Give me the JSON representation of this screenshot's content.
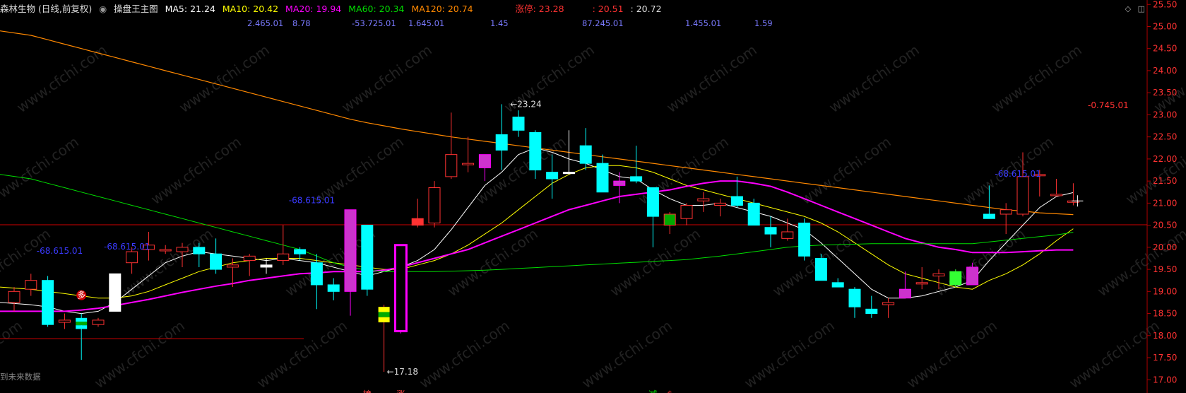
{
  "header": {
    "stock_name": "森林生物 (日线,前复权)",
    "indicator_name": "操盘王主图",
    "ma5": "MA5: 21.24",
    "ma10": "MA10: 20.42",
    "ma20": "MA20: 19.94",
    "ma60": "MA60: 20.34",
    "ma120": "MA120: 20.74",
    "limit_up": "涨停: 23.28",
    "extra1": ": 20.51",
    "extra2": ": 20.72"
  },
  "row2_values": [
    "2.465.01",
    "8.78",
    "-53.725.01",
    "1.645.01",
    "1.45",
    "87.245.01",
    "1.455.01",
    "1.59"
  ],
  "footer_hint": "到未来数据",
  "icons": [
    "diamond-icon",
    "layout-icon"
  ],
  "colors": {
    "up": "#ff3232",
    "down": "#00ffff",
    "ma5": "#ffffff",
    "ma10": "#ffff00",
    "ma20": "#ff00ff",
    "ma60": "#00dd00",
    "ma120": "#ff8800",
    "support": "#d00000"
  },
  "chart_data": {
    "type": "candlestick",
    "ylim": [
      16.7,
      25.6
    ],
    "y_ticks": [
      "25.50",
      "25.00",
      "24.50",
      "24.00",
      "23.50",
      "23.00",
      "22.50",
      "22.00",
      "21.50",
      "21.00",
      "20.50",
      "20.00",
      "19.50",
      "19.00",
      "18.50",
      "18.00",
      "17.50",
      "17.00"
    ],
    "candles": [
      {
        "o": 18.75,
        "h": 19.1,
        "l": 18.55,
        "c": 19.0
      },
      {
        "o": 19.05,
        "h": 19.4,
        "l": 18.9,
        "c": 19.25
      },
      {
        "o": 19.25,
        "h": 19.35,
        "l": 18.2,
        "c": 18.25
      },
      {
        "o": 18.3,
        "h": 18.5,
        "l": 18.15,
        "c": 18.35
      },
      {
        "o": 18.4,
        "h": 18.5,
        "l": 17.45,
        "c": 18.15
      },
      {
        "o": 18.25,
        "h": 18.4,
        "l": 18.2,
        "c": 18.35
      },
      {
        "o": 18.55,
        "h": 19.4,
        "l": 18.55,
        "c": 19.4
      },
      {
        "o": 19.65,
        "h": 20.0,
        "l": 19.4,
        "c": 19.9
      },
      {
        "o": 19.95,
        "h": 20.35,
        "l": 19.7,
        "c": 20.05
      },
      {
        "o": 19.95,
        "h": 20.05,
        "l": 19.85,
        "c": 19.95
      },
      {
        "o": 19.9,
        "h": 20.1,
        "l": 19.55,
        "c": 20.0
      },
      {
        "o": 20.0,
        "h": 20.1,
        "l": 19.55,
        "c": 19.85
      },
      {
        "o": 19.85,
        "h": 20.2,
        "l": 19.4,
        "c": 19.5
      },
      {
        "o": 19.55,
        "h": 19.75,
        "l": 19.1,
        "c": 19.6
      },
      {
        "o": 19.7,
        "h": 19.85,
        "l": 19.35,
        "c": 19.8
      },
      {
        "o": 19.6,
        "h": 19.75,
        "l": 19.4,
        "c": 19.55
      },
      {
        "o": 19.7,
        "h": 20.5,
        "l": 19.6,
        "c": 19.85
      },
      {
        "o": 19.95,
        "h": 20.0,
        "l": 19.7,
        "c": 19.85
      },
      {
        "o": 19.65,
        "h": 19.85,
        "l": 18.6,
        "c": 19.15
      },
      {
        "o": 19.15,
        "h": 19.3,
        "l": 18.8,
        "c": 19.0
      },
      {
        "o": 20.85,
        "h": 20.85,
        "l": 18.45,
        "c": 19.0
      },
      {
        "o": 20.5,
        "h": 20.5,
        "l": 18.9,
        "c": 19.05
      },
      {
        "o": 18.3,
        "h": 18.7,
        "l": 17.18,
        "c": 18.65
      },
      {
        "o": 18.1,
        "h": 20.05,
        "l": 18.05,
        "c": 20.05
      },
      {
        "o": 20.5,
        "h": 21.1,
        "l": 20.45,
        "c": 20.65
      },
      {
        "o": 20.55,
        "h": 21.5,
        "l": 20.45,
        "c": 21.35
      },
      {
        "o": 21.6,
        "h": 23.05,
        "l": 21.55,
        "c": 22.1
      },
      {
        "o": 21.9,
        "h": 22.5,
        "l": 21.7,
        "c": 21.9
      },
      {
        "o": 22.1,
        "h": 22.1,
        "l": 21.5,
        "c": 21.8
      },
      {
        "o": 22.55,
        "h": 23.24,
        "l": 21.75,
        "c": 22.2
      },
      {
        "o": 22.95,
        "h": 23.1,
        "l": 22.5,
        "c": 22.65
      },
      {
        "o": 22.6,
        "h": 22.65,
        "l": 21.55,
        "c": 21.75
      },
      {
        "o": 21.7,
        "h": 22.1,
        "l": 21.1,
        "c": 21.55
      },
      {
        "o": 21.7,
        "h": 22.65,
        "l": 21.65,
        "c": 21.7
      },
      {
        "o": 22.3,
        "h": 22.7,
        "l": 21.75,
        "c": 21.9
      },
      {
        "o": 21.9,
        "h": 22.1,
        "l": 21.25,
        "c": 21.25
      },
      {
        "o": 21.5,
        "h": 21.7,
        "l": 21.0,
        "c": 21.4
      },
      {
        "o": 21.6,
        "h": 22.3,
        "l": 21.45,
        "c": 21.5
      },
      {
        "o": 21.35,
        "h": 21.35,
        "l": 20.0,
        "c": 20.7
      },
      {
        "o": 20.5,
        "h": 20.8,
        "l": 20.3,
        "c": 20.75
      },
      {
        "o": 20.65,
        "h": 21.0,
        "l": 20.5,
        "c": 20.95
      },
      {
        "o": 21.05,
        "h": 21.25,
        "l": 20.8,
        "c": 21.1
      },
      {
        "o": 20.95,
        "h": 21.1,
        "l": 20.7,
        "c": 21.0
      },
      {
        "o": 21.15,
        "h": 21.6,
        "l": 20.9,
        "c": 20.95
      },
      {
        "o": 21.0,
        "h": 21.1,
        "l": 20.5,
        "c": 20.5
      },
      {
        "o": 20.45,
        "h": 20.7,
        "l": 20.0,
        "c": 20.3
      },
      {
        "o": 20.2,
        "h": 20.65,
        "l": 20.15,
        "c": 20.35
      },
      {
        "o": 20.55,
        "h": 20.65,
        "l": 19.7,
        "c": 19.8
      },
      {
        "o": 19.75,
        "h": 19.85,
        "l": 19.25,
        "c": 19.25
      },
      {
        "o": 19.2,
        "h": 19.3,
        "l": 19.1,
        "c": 19.1
      },
      {
        "o": 19.05,
        "h": 19.1,
        "l": 18.4,
        "c": 18.65
      },
      {
        "o": 18.6,
        "h": 18.9,
        "l": 18.4,
        "c": 18.5
      },
      {
        "o": 18.7,
        "h": 18.85,
        "l": 18.4,
        "c": 18.75
      },
      {
        "o": 18.85,
        "h": 19.45,
        "l": 18.85,
        "c": 19.05
      },
      {
        "o": 19.2,
        "h": 19.55,
        "l": 19.05,
        "c": 19.2
      },
      {
        "o": 19.35,
        "h": 19.5,
        "l": 19.05,
        "c": 19.4
      },
      {
        "o": 19.45,
        "h": 19.5,
        "l": 19.1,
        "c": 19.15
      },
      {
        "o": 19.15,
        "h": 19.65,
        "l": 19.15,
        "c": 19.55
      },
      {
        "o": 20.65,
        "h": 21.4,
        "l": 20.65,
        "c": 20.75
      },
      {
        "o": 20.75,
        "h": 21.0,
        "l": 20.3,
        "c": 20.85
      },
      {
        "o": 20.75,
        "h": 22.15,
        "l": 20.7,
        "c": 21.6
      },
      {
        "o": 21.65,
        "h": 21.75,
        "l": 21.15,
        "c": 21.65
      },
      {
        "o": 21.2,
        "h": 21.55,
        "l": 21.15,
        "c": 21.2
      },
      {
        "o": 21.05,
        "h": 21.45,
        "l": 20.95,
        "c": 21.05
      }
    ],
    "candle_styles": {
      "2": "cyan",
      "4": "green-yellow",
      "6": "white",
      "15": "white",
      "20": "magenta",
      "22": "yellow-green",
      "23": "magenta-hollow",
      "24": "red-fill",
      "28": "magenta",
      "33": "white",
      "36": "magenta",
      "39": "green",
      "53": "magenta",
      "56": "lime",
      "57": "magenta",
      "58": "cyan"
    },
    "ma_series": [
      {
        "name": "MA5",
        "values": [
          18.75,
          18.7,
          18.65,
          18.55,
          18.5,
          18.55,
          18.75,
          19.05,
          19.35,
          19.65,
          19.8,
          19.9,
          19.85,
          19.8,
          19.75,
          19.7,
          19.75,
          19.7,
          19.65,
          19.55,
          19.45,
          19.35,
          19.45,
          19.55,
          19.7,
          19.95,
          20.4,
          20.9,
          21.4,
          21.7,
          22.1,
          22.25,
          22.15,
          22.0,
          21.9,
          21.75,
          21.6,
          21.55,
          21.3,
          21.1,
          20.95,
          20.95,
          21.0,
          20.9,
          20.8,
          20.7,
          20.55,
          20.4,
          20.1,
          19.75,
          19.4,
          19.05,
          18.85,
          18.85,
          18.9,
          19.0,
          19.1,
          19.25,
          19.7,
          20.1,
          20.5,
          20.9,
          21.15,
          21.24
        ]
      },
      {
        "name": "MA10",
        "values": [
          19.1,
          19.05,
          19.0,
          18.95,
          18.9,
          18.85,
          18.85,
          18.9,
          19.0,
          19.15,
          19.3,
          19.45,
          19.55,
          19.65,
          19.7,
          19.75,
          19.75,
          19.75,
          19.7,
          19.65,
          19.6,
          19.55,
          19.5,
          19.5,
          19.6,
          19.7,
          19.85,
          20.05,
          20.3,
          20.55,
          20.85,
          21.15,
          21.45,
          21.65,
          21.8,
          21.85,
          21.85,
          21.8,
          21.7,
          21.55,
          21.4,
          21.3,
          21.2,
          21.1,
          21.0,
          20.9,
          20.8,
          20.7,
          20.55,
          20.35,
          20.1,
          19.85,
          19.6,
          19.4,
          19.3,
          19.2,
          19.1,
          19.05,
          19.25,
          19.4,
          19.6,
          19.85,
          20.15,
          20.42
        ]
      },
      {
        "name": "MA20",
        "values": [
          18.55,
          18.55,
          18.55,
          18.55,
          18.58,
          18.62,
          18.68,
          18.75,
          18.82,
          18.9,
          18.98,
          19.05,
          19.12,
          19.18,
          19.25,
          19.3,
          19.35,
          19.4,
          19.42,
          19.45,
          19.45,
          19.45,
          19.48,
          19.55,
          19.65,
          19.75,
          19.85,
          19.95,
          20.1,
          20.25,
          20.4,
          20.55,
          20.7,
          20.85,
          20.95,
          21.05,
          21.15,
          21.2,
          21.25,
          21.3,
          21.38,
          21.45,
          21.5,
          21.5,
          21.45,
          21.38,
          21.25,
          21.1,
          20.95,
          20.8,
          20.65,
          20.5,
          20.35,
          20.2,
          20.1,
          20.0,
          19.95,
          19.88,
          19.88,
          19.88,
          19.9,
          19.92,
          19.94,
          19.94
        ]
      },
      {
        "name": "MA60",
        "values": [
          21.65,
          21.55,
          21.45,
          21.35,
          21.25,
          21.15,
          21.05,
          20.95,
          20.85,
          20.75,
          20.65,
          20.55,
          20.45,
          20.35,
          20.25,
          20.15,
          20.05,
          19.95,
          19.8,
          19.65,
          19.55,
          19.48,
          19.45,
          19.45,
          19.45,
          19.45,
          19.46,
          19.47,
          19.48,
          19.5,
          19.52,
          19.54,
          19.56,
          19.58,
          19.6,
          19.62,
          19.64,
          19.66,
          19.68,
          19.7,
          19.72,
          19.76,
          19.8,
          19.85,
          19.9,
          19.95,
          20.0,
          20.03,
          20.05,
          20.06,
          20.07,
          20.08,
          20.08,
          20.08,
          20.08,
          20.08,
          20.08,
          20.08,
          20.12,
          20.16,
          20.2,
          20.24,
          20.28,
          20.34
        ]
      },
      {
        "name": "MA120",
        "values": [
          24.9,
          24.8,
          24.7,
          24.6,
          24.5,
          24.4,
          24.3,
          24.2,
          24.1,
          24.0,
          23.9,
          23.8,
          23.7,
          23.6,
          23.5,
          23.4,
          23.3,
          23.2,
          23.1,
          23.0,
          22.9,
          22.82,
          22.75,
          22.68,
          22.62,
          22.56,
          22.5,
          22.45,
          22.4,
          22.35,
          22.3,
          22.25,
          22.2,
          22.15,
          22.1,
          22.05,
          22.0,
          21.95,
          21.9,
          21.85,
          21.8,
          21.75,
          21.7,
          21.65,
          21.6,
          21.55,
          21.5,
          21.45,
          21.4,
          21.35,
          21.3,
          21.25,
          21.2,
          21.15,
          21.1,
          21.05,
          21.0,
          20.95,
          20.9,
          20.85,
          20.82,
          20.78,
          20.76,
          20.74
        ]
      }
    ],
    "support_lines": [
      20.51,
      17.93
    ],
    "annotations": [
      {
        "text": "23.24",
        "at_candle": 29,
        "price": 23.24
      },
      {
        "text": "17.18",
        "at_candle": 22,
        "price": 17.18
      },
      {
        "text": "-0.745.01",
        "price": 23.15,
        "side": "right"
      },
      {
        "text": "-68.615.01",
        "at_candle": 1,
        "price": 19.85,
        "color": "#3a3aff"
      },
      {
        "text": "-68.615.01",
        "at_candle": 5,
        "price": 19.95,
        "color": "#3a3aff"
      },
      {
        "text": "-68.615.01",
        "at_candle": 16,
        "price": 21.0,
        "color": "#3a3aff"
      },
      {
        "text": "-68.615.01",
        "at_candle": 58,
        "price": 21.6,
        "color": "#3a3aff"
      }
    ],
    "signals": [
      {
        "text": "多",
        "at_candle": 4,
        "price": 18.85,
        "color": "#ff3232",
        "circle": true
      },
      {
        "text": "榜",
        "at_candle": 21,
        "price": 16.6,
        "color": "#ff4444"
      },
      {
        "text": "涨",
        "at_candle": 23,
        "price": 16.6,
        "color": "#ff4444"
      },
      {
        "text": "减",
        "at_candle": 38,
        "price": 16.6,
        "color": "#00dd00"
      },
      {
        "text": "$",
        "at_candle": 39,
        "price": 16.6,
        "color": "#ff3232"
      }
    ],
    "watermark": "www.cfchi.com"
  }
}
